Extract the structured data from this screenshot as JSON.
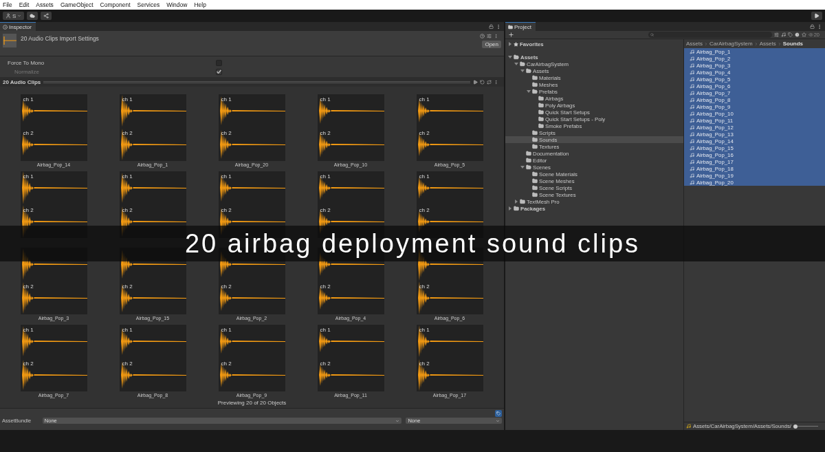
{
  "menu": [
    "File",
    "Edit",
    "Assets",
    "GameObject",
    "Component",
    "Services",
    "Window",
    "Help"
  ],
  "toolbar": {
    "account": "S"
  },
  "inspector": {
    "tab": "Inspector",
    "title": "20 Audio Clips Import Settings",
    "open_button": "Open",
    "properties": [
      {
        "label": "Force To Mono",
        "checked": false,
        "disabled": false
      },
      {
        "label": "Normalize",
        "checked": true,
        "disabled": true
      }
    ],
    "preview": {
      "title": "20 Audio Clips",
      "clips": [
        {
          "name": "Airbag_Pop_14",
          "top_label": "ch 1",
          "bottom_label": "ch 2"
        },
        {
          "name": "Airbag_Pop_1",
          "top_label": "ch 1",
          "bottom_label": "ch 2"
        },
        {
          "name": "Airbag_Pop_20",
          "top_label": "ch 1",
          "bottom_label": "ch 2"
        },
        {
          "name": "Airbag_Pop_10",
          "top_label": "ch 1",
          "bottom_label": "ch 2"
        },
        {
          "name": "Airbag_Pop_5",
          "top_label": "ch 1",
          "bottom_label": "ch 2"
        },
        {
          "top_label": "ch 1",
          "bottom_label": "ch 2"
        },
        {
          "top_label": "ch 1",
          "bottom_label": "ch 2"
        },
        {
          "top_label": "ch 1",
          "bottom_label": "ch 2"
        },
        {
          "top_label": "ch 1",
          "bottom_label": "ch 2"
        },
        {
          "top_label": "ch 1",
          "bottom_label": "ch 2"
        },
        {
          "name": "Airbag_Pop_3",
          "bottom_label": "ch 2"
        },
        {
          "name": "Airbag_Pop_15",
          "bottom_label": "ch 2"
        },
        {
          "name": "Airbag_Pop_2",
          "bottom_label": "ch 2"
        },
        {
          "name": "Airbag_Pop_4",
          "bottom_label": "ch 2"
        },
        {
          "name": "Airbag_Pop_6",
          "bottom_label": "ch 2"
        },
        {
          "name": "Airbag_Pop_7",
          "top_label": "ch 1",
          "bottom_label": "ch 2"
        },
        {
          "name": "Airbag_Pop_8",
          "top_label": "ch 1",
          "bottom_label": "ch 2"
        },
        {
          "name": "Airbag_Pop_9",
          "top_label": "ch 1",
          "bottom_label": "ch 2"
        },
        {
          "name": "Airbag_Pop_11",
          "top_label": "ch 1",
          "bottom_label": "ch 2"
        },
        {
          "name": "Airbag_Pop_17",
          "top_label": "ch 1",
          "bottom_label": "ch 2"
        }
      ],
      "status": "Previewing 20 of 20 Objects"
    },
    "asset_bundle": {
      "label": "AssetBundle",
      "name": "None",
      "variant": "None"
    }
  },
  "project": {
    "tab": "Project",
    "visible_count": "20",
    "tree": [
      {
        "label": "Favorites",
        "bold": true,
        "kind": "favorites",
        "expanded": false,
        "selected": false
      },
      {
        "label": "Assets",
        "bold": true,
        "kind": "folder",
        "expanded": true,
        "selected": false,
        "children": [
          {
            "label": "CarAirbagSystem",
            "kind": "folder",
            "expanded": true,
            "selected": false,
            "children": [
              {
                "label": "Assets",
                "kind": "folder",
                "expanded": true,
                "selected": false,
                "children": [
                  {
                    "label": "Materials",
                    "kind": "folder",
                    "selected": false
                  },
                  {
                    "label": "Meshes",
                    "kind": "folder",
                    "selected": false
                  },
                  {
                    "label": "Prefabs",
                    "kind": "folder",
                    "expanded": true,
                    "selected": false,
                    "children": [
                      {
                        "label": "Airbags",
                        "kind": "folder",
                        "selected": false
                      },
                      {
                        "label": "Poly Airbags",
                        "kind": "folder",
                        "selected": false
                      },
                      {
                        "label": "Quick Start Setups",
                        "kind": "folder",
                        "selected": false
                      },
                      {
                        "label": "Quick Start Setups - Poly",
                        "kind": "folder",
                        "selected": false
                      },
                      {
                        "label": "Smoke Prefabs",
                        "kind": "folder",
                        "selected": false
                      }
                    ]
                  },
                  {
                    "label": "Scripts",
                    "kind": "folder",
                    "selected": false
                  },
                  {
                    "label": "Sounds",
                    "kind": "folder",
                    "selected": true
                  },
                  {
                    "label": "Textures",
                    "kind": "folder",
                    "selected": false
                  }
                ]
              },
              {
                "label": "Documentation",
                "kind": "folder",
                "selected": false
              },
              {
                "label": "Editor",
                "kind": "folder",
                "selected": false
              },
              {
                "label": "Scenes",
                "kind": "folder",
                "expanded": true,
                "selected": false,
                "children": [
                  {
                    "label": "Scene Materials",
                    "kind": "folder",
                    "selected": false
                  },
                  {
                    "label": "Scene Meshes",
                    "kind": "folder",
                    "selected": false
                  },
                  {
                    "label": "Scene Scripts",
                    "kind": "folder",
                    "selected": false
                  },
                  {
                    "label": "Scene Textures",
                    "kind": "folder",
                    "selected": false
                  }
                ]
              }
            ]
          },
          {
            "label": "TextMesh Pro",
            "kind": "folder",
            "expanded": false,
            "selected": false
          }
        ]
      },
      {
        "label": "Packages",
        "bold": true,
        "kind": "folder",
        "expanded": false,
        "selected": false
      }
    ],
    "breadcrumb": [
      {
        "label": "Assets",
        "selected": false
      },
      {
        "label": "CarAirbagSystem",
        "selected": false
      },
      {
        "label": "Assets",
        "selected": false
      },
      {
        "label": "Sounds",
        "selected": true
      }
    ],
    "files": [
      {
        "name": "Airbag_Pop_1",
        "selected": true
      },
      {
        "name": "Airbag_Pop_2",
        "selected": true
      },
      {
        "name": "Airbag_Pop_3",
        "selected": true
      },
      {
        "name": "Airbag_Pop_4",
        "selected": true
      },
      {
        "name": "Airbag_Pop_5",
        "selected": true
      },
      {
        "name": "Airbag_Pop_6",
        "selected": true
      },
      {
        "name": "Airbag_Pop_7",
        "selected": true
      },
      {
        "name": "Airbag_Pop_8",
        "selected": true
      },
      {
        "name": "Airbag_Pop_9",
        "selected": true
      },
      {
        "name": "Airbag_Pop_10",
        "selected": true
      },
      {
        "name": "Airbag_Pop_11",
        "selected": true
      },
      {
        "name": "Airbag_Pop_12",
        "selected": true
      },
      {
        "name": "Airbag_Pop_13",
        "selected": true
      },
      {
        "name": "Airbag_Pop_14",
        "selected": true
      },
      {
        "name": "Airbag_Pop_15",
        "selected": true
      },
      {
        "name": "Airbag_Pop_16",
        "selected": true
      },
      {
        "name": "Airbag_Pop_17",
        "selected": true
      },
      {
        "name": "Airbag_Pop_18",
        "selected": true
      },
      {
        "name": "Airbag_Pop_19",
        "selected": true
      },
      {
        "name": "Airbag_Pop_20",
        "selected": true
      }
    ],
    "path": "Assets/CarAirbagSystem/Assets/Sounds/",
    "zoom": {
      "level": 0
    }
  },
  "banner": "20 airbag deployment sound clips"
}
